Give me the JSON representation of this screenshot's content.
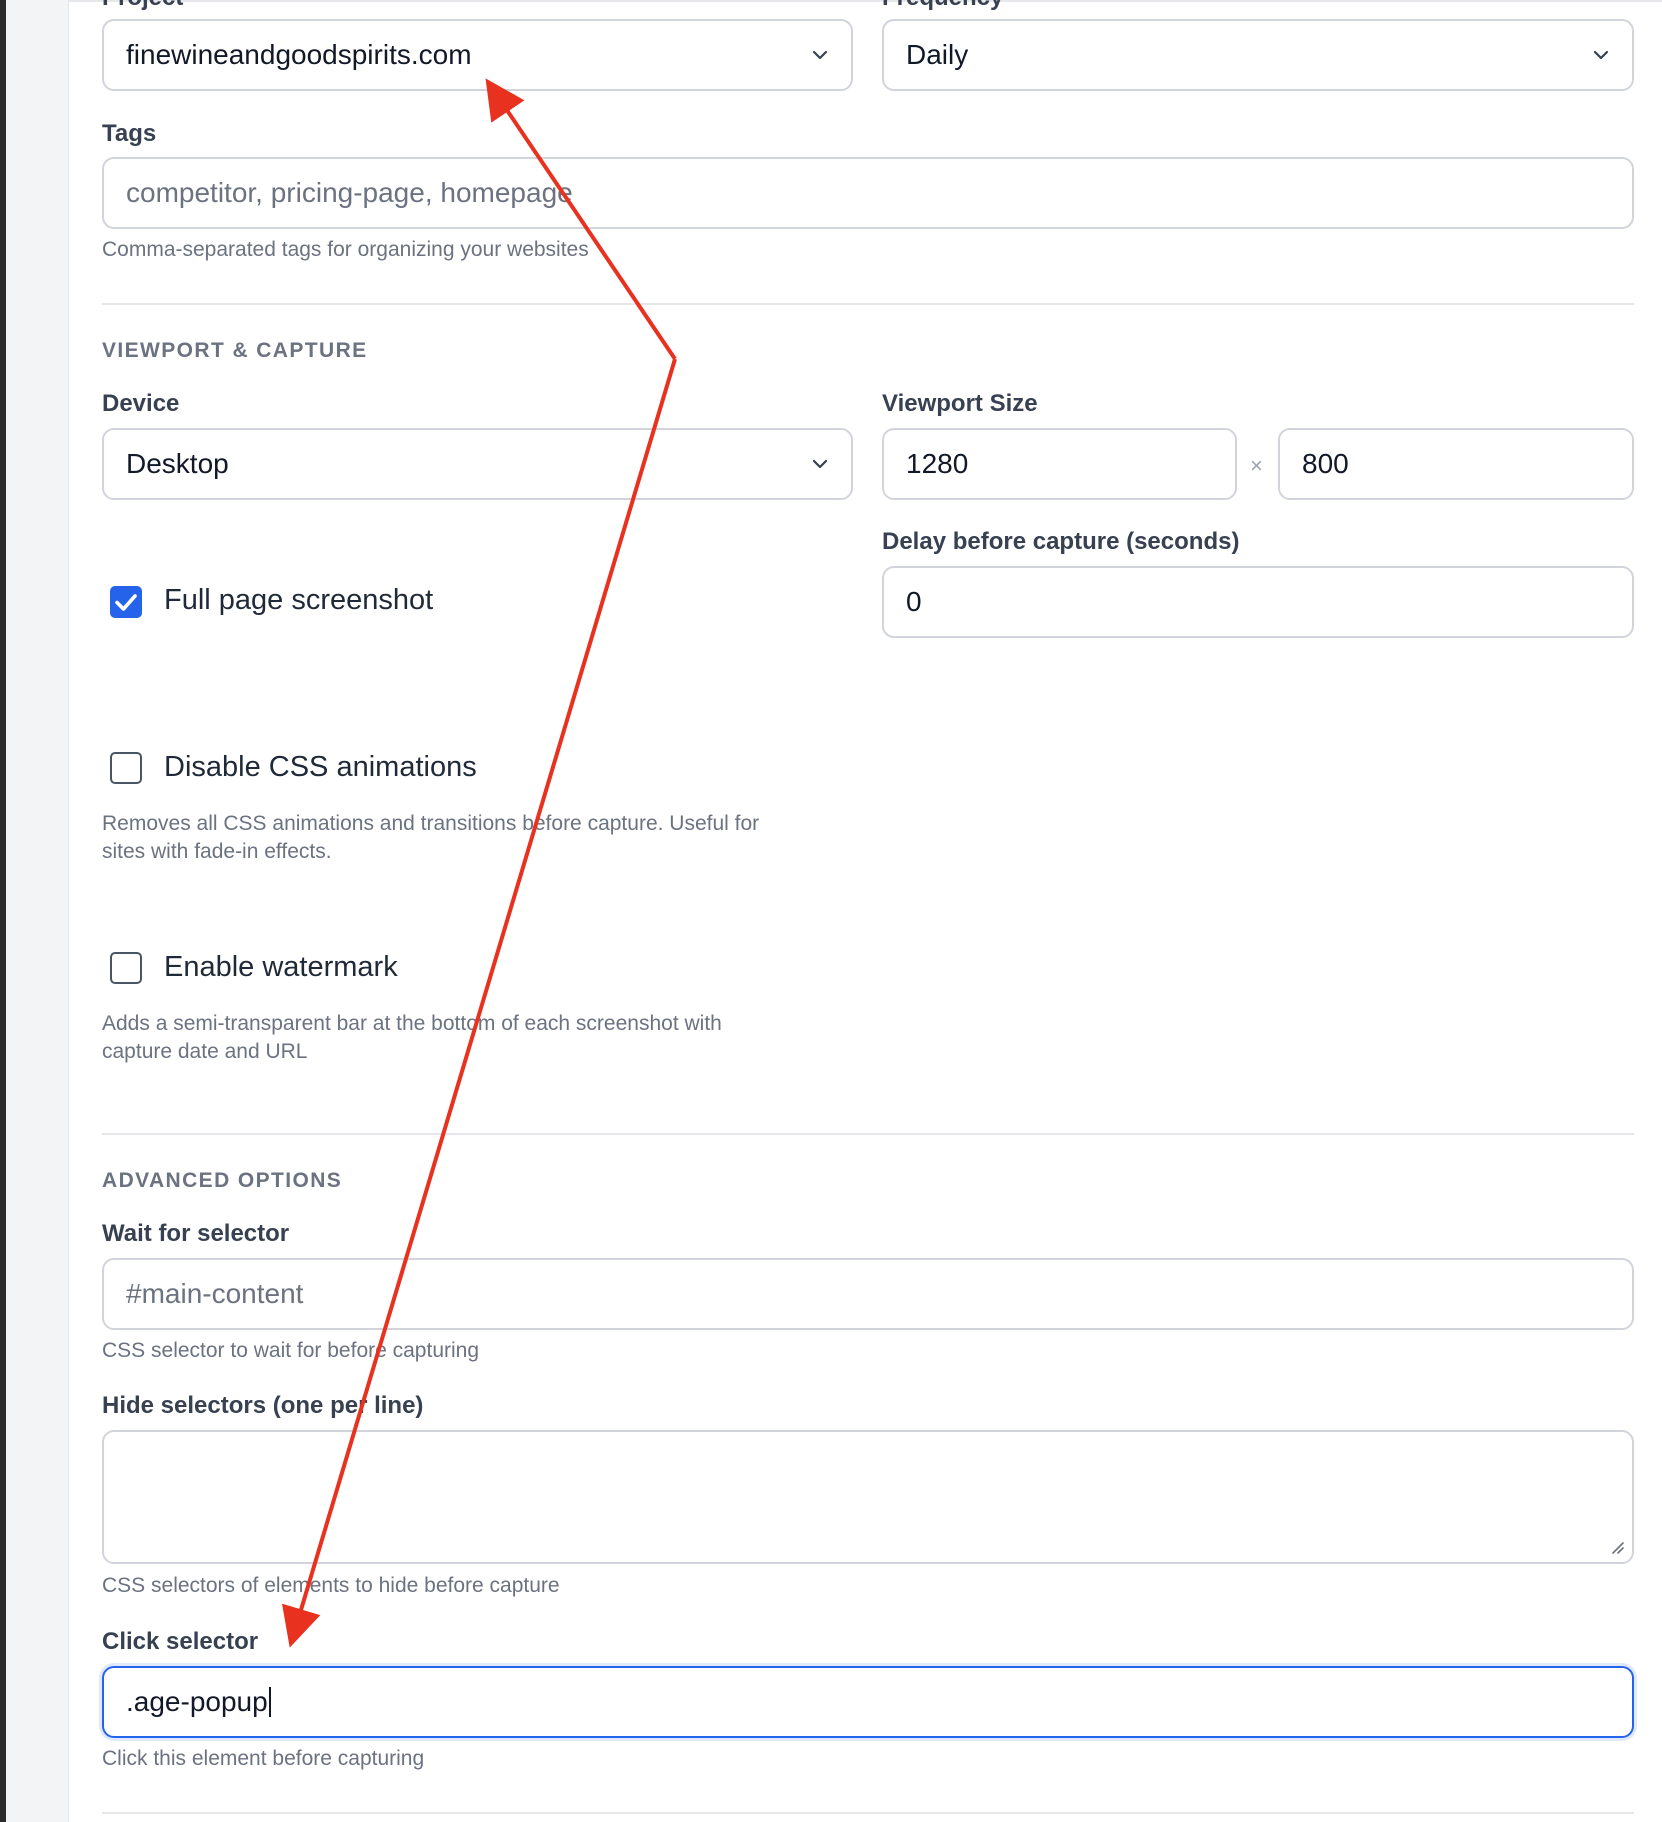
{
  "header": {
    "project_label": "Project",
    "frequency_label": "Frequency"
  },
  "project": {
    "value": "finewineandgoodspirits.com"
  },
  "frequency": {
    "value": "Daily"
  },
  "tags": {
    "label": "Tags",
    "placeholder": "competitor, pricing-page, homepage",
    "help": "Comma-separated tags for organizing your websites"
  },
  "viewport": {
    "section_title": "VIEWPORT & CAPTURE",
    "device_label": "Device",
    "device_value": "Desktop",
    "size_label": "Viewport Size",
    "width": "1280",
    "separator": "×",
    "height": "800",
    "delay_label": "Delay before capture (seconds)",
    "delay_value": "0"
  },
  "options": {
    "full_page": {
      "label": "Full page screenshot",
      "checked": true
    },
    "disable_css": {
      "label": "Disable CSS animations",
      "checked": false,
      "help_line1": "Removes all CSS animations and transitions before capture. Useful for",
      "help_line2": "sites with fade-in effects."
    },
    "watermark": {
      "label": "Enable watermark",
      "checked": false,
      "help_line1": "Adds a semi-transparent bar at the bottom of each screenshot with",
      "help_line2": "capture date and URL"
    }
  },
  "advanced": {
    "section_title": "ADVANCED OPTIONS",
    "wait_label": "Wait for selector",
    "wait_placeholder": "#main-content",
    "wait_help": "CSS selector to wait for before capturing",
    "hide_label": "Hide selectors (one per line)",
    "hide_help": "CSS selectors of elements to hide before capture",
    "click_label": "Click selector",
    "click_value": ".age-popup",
    "click_help": "Click this element before capturing"
  },
  "colors": {
    "accent": "#2563eb",
    "annotation": "#e8321f"
  },
  "icons": [
    "chevron-down-icon",
    "check-icon",
    "resize-handle-icon"
  ]
}
